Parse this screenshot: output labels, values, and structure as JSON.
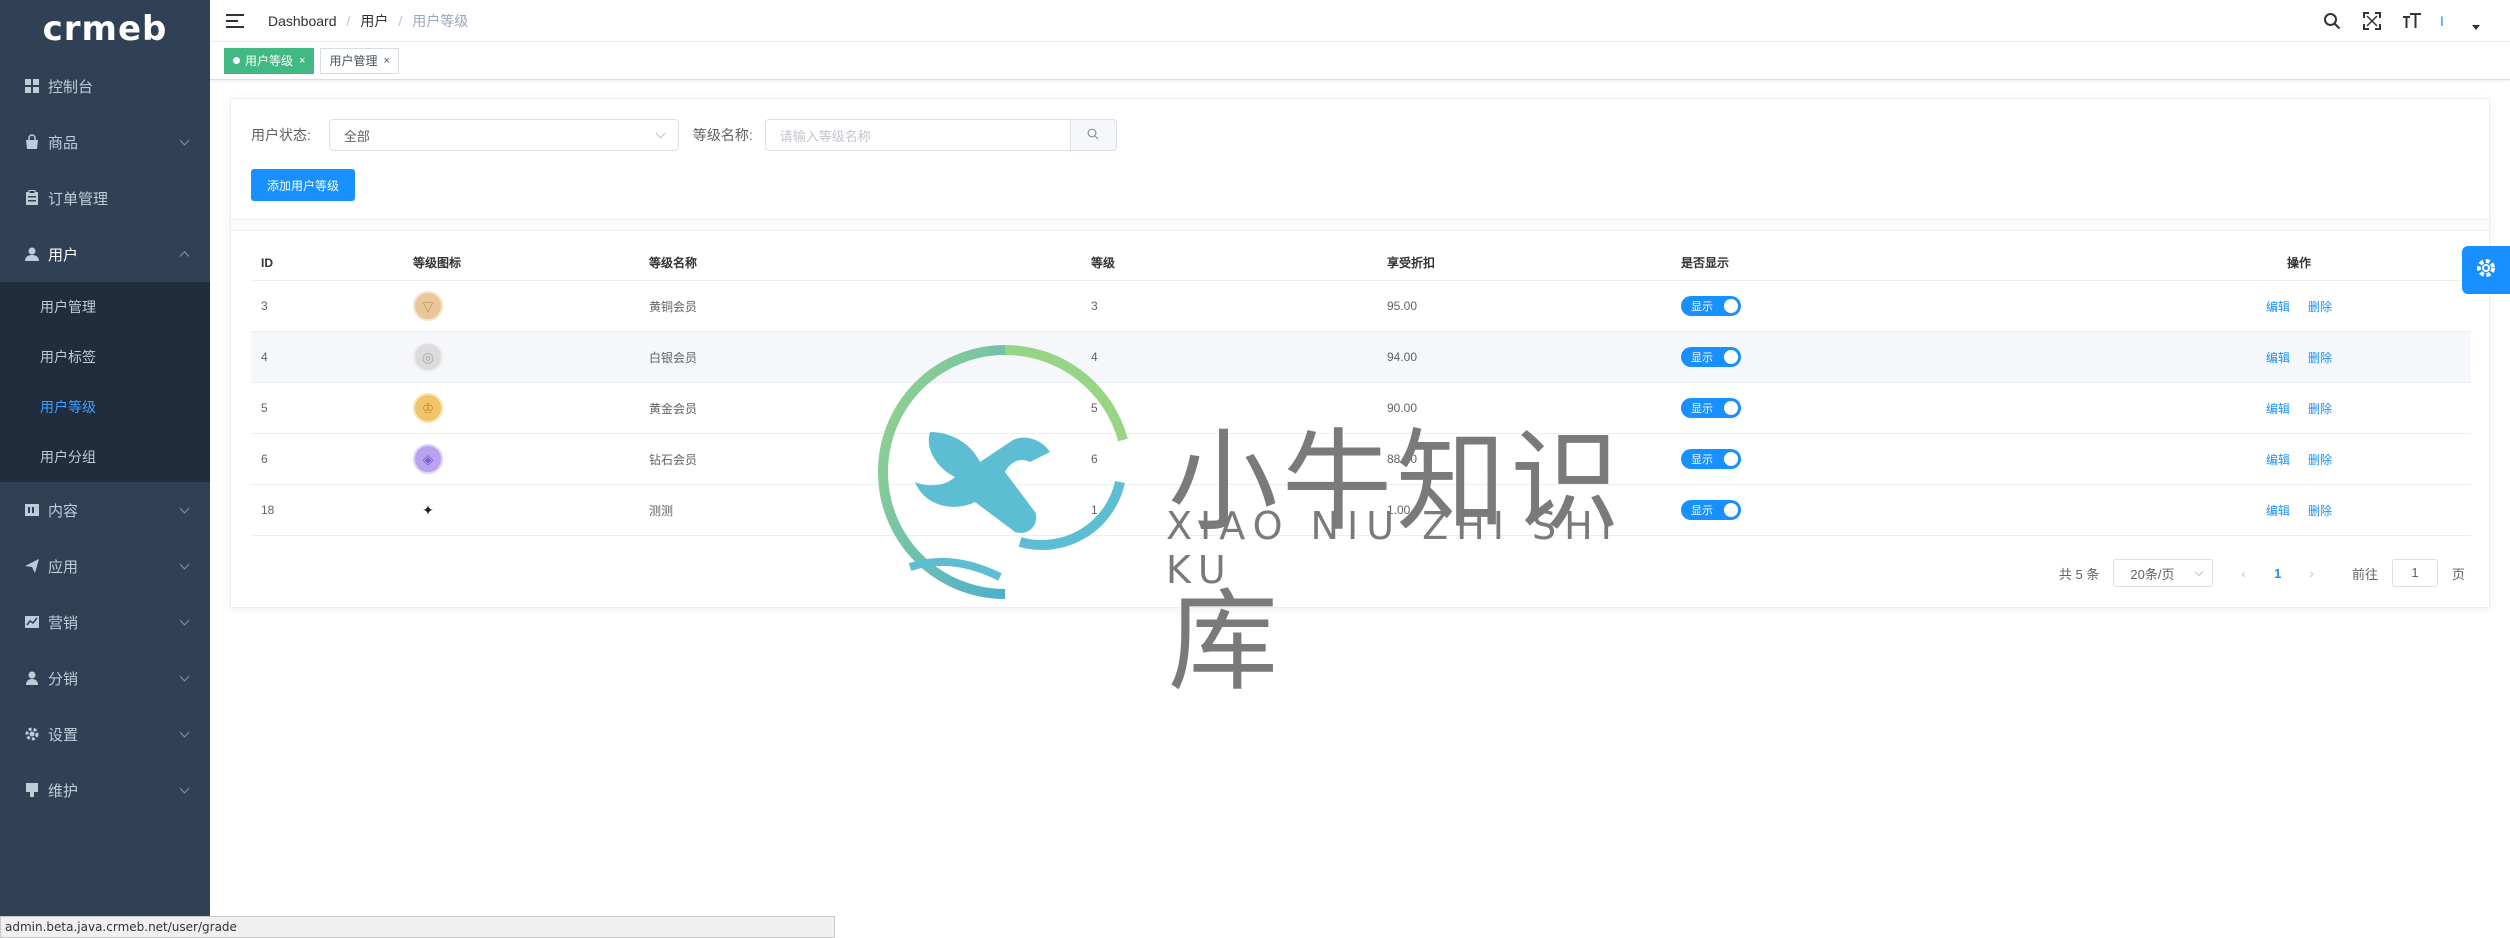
{
  "app": {
    "logo": "crmeb"
  },
  "sidebar": {
    "items": [
      {
        "label": "控制台",
        "icon": "dashboard-icon"
      },
      {
        "label": "商品",
        "icon": "shop-bag-icon"
      },
      {
        "label": "订单管理",
        "icon": "clipboard-icon"
      },
      {
        "label": "用户",
        "icon": "user-icon",
        "open": true,
        "children": [
          {
            "label": "用户管理"
          },
          {
            "label": "用户标签"
          },
          {
            "label": "用户等级",
            "active": true
          },
          {
            "label": "用户分组"
          }
        ]
      },
      {
        "label": "内容",
        "icon": "content-icon"
      },
      {
        "label": "应用",
        "icon": "send-icon"
      },
      {
        "label": "营销",
        "icon": "marketing-icon"
      },
      {
        "label": "分销",
        "icon": "distribution-icon"
      },
      {
        "label": "设置",
        "icon": "settings-icon"
      },
      {
        "label": "维护",
        "icon": "maintenance-icon"
      }
    ]
  },
  "header": {
    "breadcrumb": [
      "Dashboard",
      "用户",
      "用户等级"
    ],
    "user_indicator": "I"
  },
  "tags": [
    {
      "label": "用户等级",
      "active": true
    },
    {
      "label": "用户管理",
      "active": false
    }
  ],
  "filter": {
    "status_label": "用户状态:",
    "status_value": "全部",
    "name_label": "等级名称:",
    "name_placeholder": "请输入等级名称"
  },
  "add_button": "添加用户等级",
  "table": {
    "headers": [
      "ID",
      "等级图标",
      "等级名称",
      "等级",
      "享受折扣",
      "是否显示",
      "操作"
    ],
    "rows": [
      {
        "id": "3",
        "icon": "bronze-level-icon",
        "icon_color": "#e8c79a",
        "name": "黄铜会员",
        "grade": "3",
        "discount": "95.00",
        "show": "显示",
        "edit": "编辑",
        "delete": "删除"
      },
      {
        "id": "4",
        "icon": "silver-level-icon",
        "icon_color": "#cfcfcf",
        "name": "白银会员",
        "grade": "4",
        "discount": "94.00",
        "show": "显示",
        "edit": "编辑",
        "delete": "删除"
      },
      {
        "id": "5",
        "icon": "gold-level-icon",
        "icon_color": "#f0c56a",
        "name": "黄金会员",
        "grade": "5",
        "discount": "90.00",
        "show": "显示",
        "edit": "编辑",
        "delete": "删除"
      },
      {
        "id": "6",
        "icon": "diamond-level-icon",
        "icon_color": "#b9a3f0",
        "name": "钻石会员",
        "grade": "6",
        "discount": "88.00",
        "show": "显示",
        "edit": "编辑",
        "delete": "删除"
      },
      {
        "id": "18",
        "icon": "custom-level-icon",
        "icon_color": "#ffffff",
        "name": "测测",
        "grade": "1",
        "discount": "1.00",
        "show": "显示",
        "edit": "编辑",
        "delete": "删除"
      }
    ]
  },
  "pagination": {
    "total": "共 5 条",
    "page_size": "20条/页",
    "current": "1",
    "goto_label": "前往",
    "goto_value": "1",
    "page_suffix": "页"
  },
  "watermark": {
    "title": "小牛知识库",
    "subtitle": "XIAO NIU ZHI SHI KU"
  },
  "status_bar": {
    "url": "admin.beta.java.crmeb.net/user/grade"
  },
  "colors": {
    "sidebar_bg": "#304156",
    "primary": "#1890ff",
    "tag_active": "#42b983"
  }
}
